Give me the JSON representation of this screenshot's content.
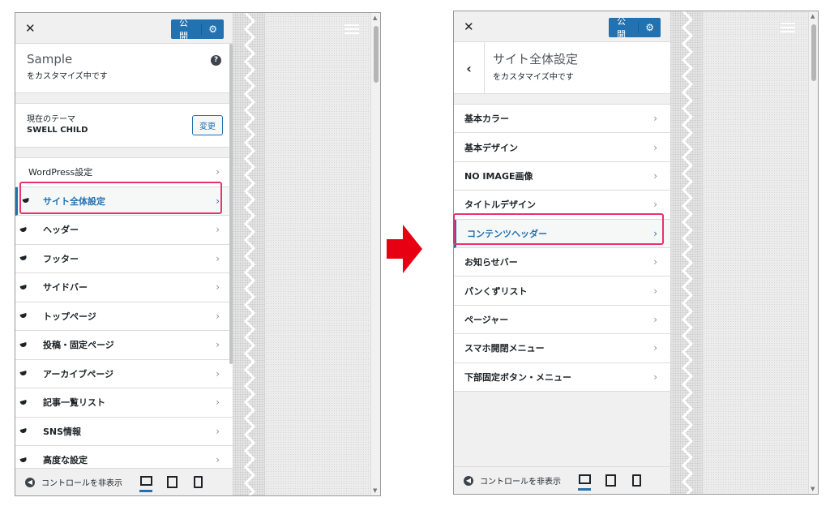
{
  "left": {
    "close_glyph": "✕",
    "publish_label": "公開",
    "gear_glyph": "⚙",
    "site_title": "Sample",
    "customizing_text": "をカスタマイズ中です",
    "help_glyph": "?",
    "theme_label": "現在のテーマ",
    "theme_name": "SWELL CHILD",
    "change_label": "変更",
    "menu_items": [
      {
        "label": "WordPress設定"
      },
      {
        "label": "サイト全体設定"
      },
      {
        "label": "ヘッダー"
      },
      {
        "label": "フッター"
      },
      {
        "label": "サイドバー"
      },
      {
        "label": "トップページ"
      },
      {
        "label": "投稿・固定ページ"
      },
      {
        "label": "アーカイブページ"
      },
      {
        "label": "記事一覧リスト"
      },
      {
        "label": "SNS情報"
      },
      {
        "label": "高度な設定"
      }
    ],
    "footer": {
      "collapse_label": "コントロールを非表示"
    }
  },
  "right": {
    "close_glyph": "✕",
    "publish_label": "公開",
    "gear_glyph": "⚙",
    "back_glyph": "‹",
    "section_title": "サイト全体設定",
    "customizing_text": "をカスタマイズ中です",
    "menu_items": [
      {
        "label": "基本カラー"
      },
      {
        "label": "基本デザイン"
      },
      {
        "label": "NO IMAGE画像"
      },
      {
        "label": "タイトルデザイン"
      },
      {
        "label": "コンテンツヘッダー"
      },
      {
        "label": "お知らせバー"
      },
      {
        "label": "パンくずリスト"
      },
      {
        "label": "ページャー"
      },
      {
        "label": "スマホ開閉メニュー"
      },
      {
        "label": "下部固定ボタン・メニュー"
      }
    ],
    "footer": {
      "collapse_label": "コントロールを非表示"
    }
  },
  "chevron_glyph": "›",
  "colors": {
    "accent": "#2271b1",
    "highlight": "#e8336f",
    "arrow": "#e60012"
  }
}
